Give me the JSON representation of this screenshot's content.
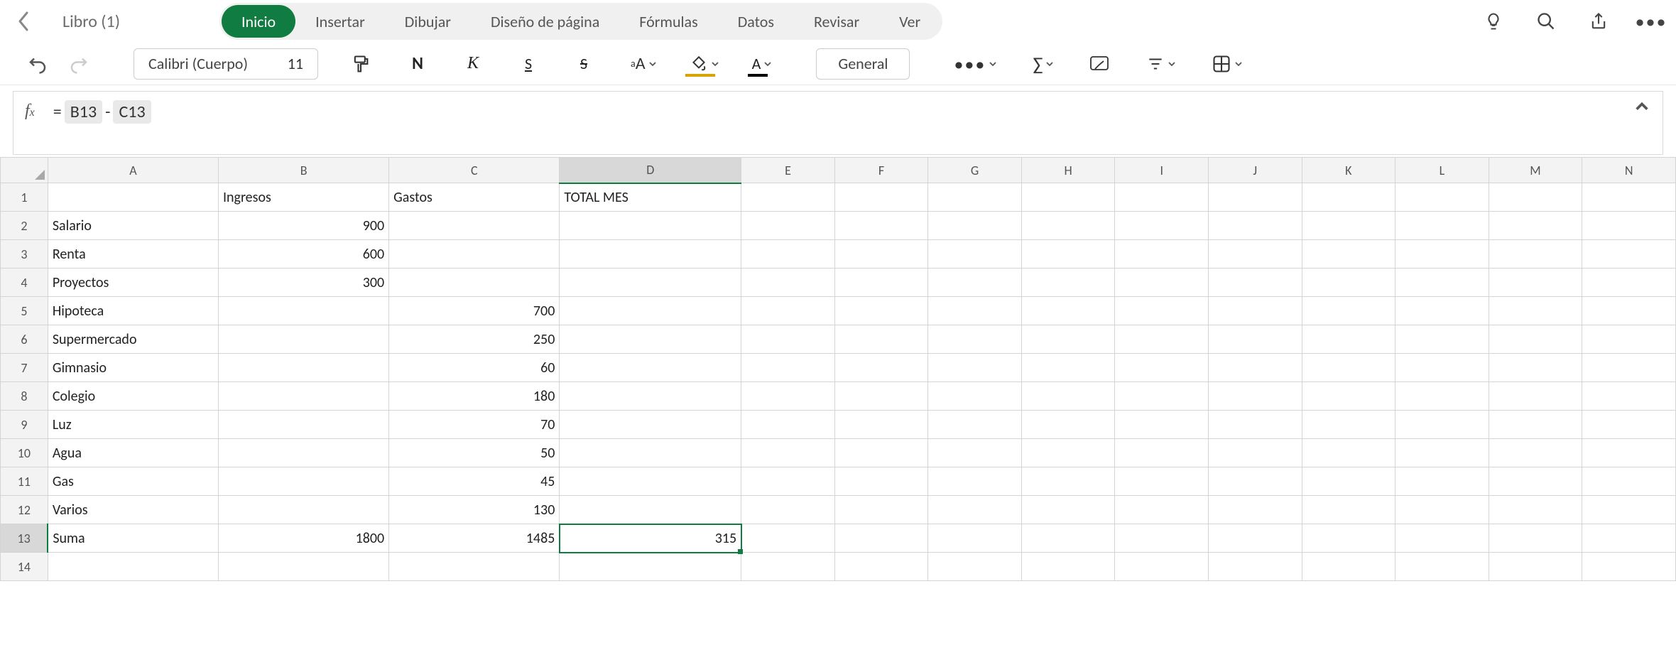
{
  "filename": "Libro (1)",
  "tabs": {
    "inicio": "Inicio",
    "insertar": "Insertar",
    "dibujar": "Dibujar",
    "diseno": "Diseño de página",
    "formulas": "Fórmulas",
    "datos": "Datos",
    "revisar": "Revisar",
    "ver": "Ver"
  },
  "toolbar": {
    "font_name": "Calibri (Cuerpo)",
    "font_size": "11",
    "number_format": "General"
  },
  "formula": {
    "eq": "=",
    "ref1": "B13",
    "minus": "-",
    "ref2": "C13",
    "raw": "= B13 - C13"
  },
  "columns": [
    "A",
    "B",
    "C",
    "D",
    "E",
    "F",
    "G",
    "H",
    "I",
    "J",
    "K",
    "L",
    "M",
    "N"
  ],
  "selected": {
    "col": "D",
    "row": 13
  },
  "rows_count": 14,
  "headers": {
    "B1": "Ingresos",
    "C1": "Gastos",
    "D1": "TOTAL MES"
  },
  "data": {
    "A2": "Salario",
    "B2": "900",
    "A3": "Renta",
    "B3": "600",
    "A4": "Proyectos",
    "B4": "300",
    "A5": "Hipoteca",
    "C5": "700",
    "A6": "Supermercado",
    "C6": "250",
    "A7": "Gimnasio",
    "C7": "60",
    "A8": "Colegio",
    "C8": "180",
    "A9": "Luz",
    "C9": "70",
    "A10": "Agua",
    "C10": "50",
    "A11": "Gas",
    "C11": "45",
    "A12": "Varios",
    "C12": "130",
    "A13": "Suma",
    "B13": "1800",
    "C13": "1485",
    "D13": "315"
  }
}
